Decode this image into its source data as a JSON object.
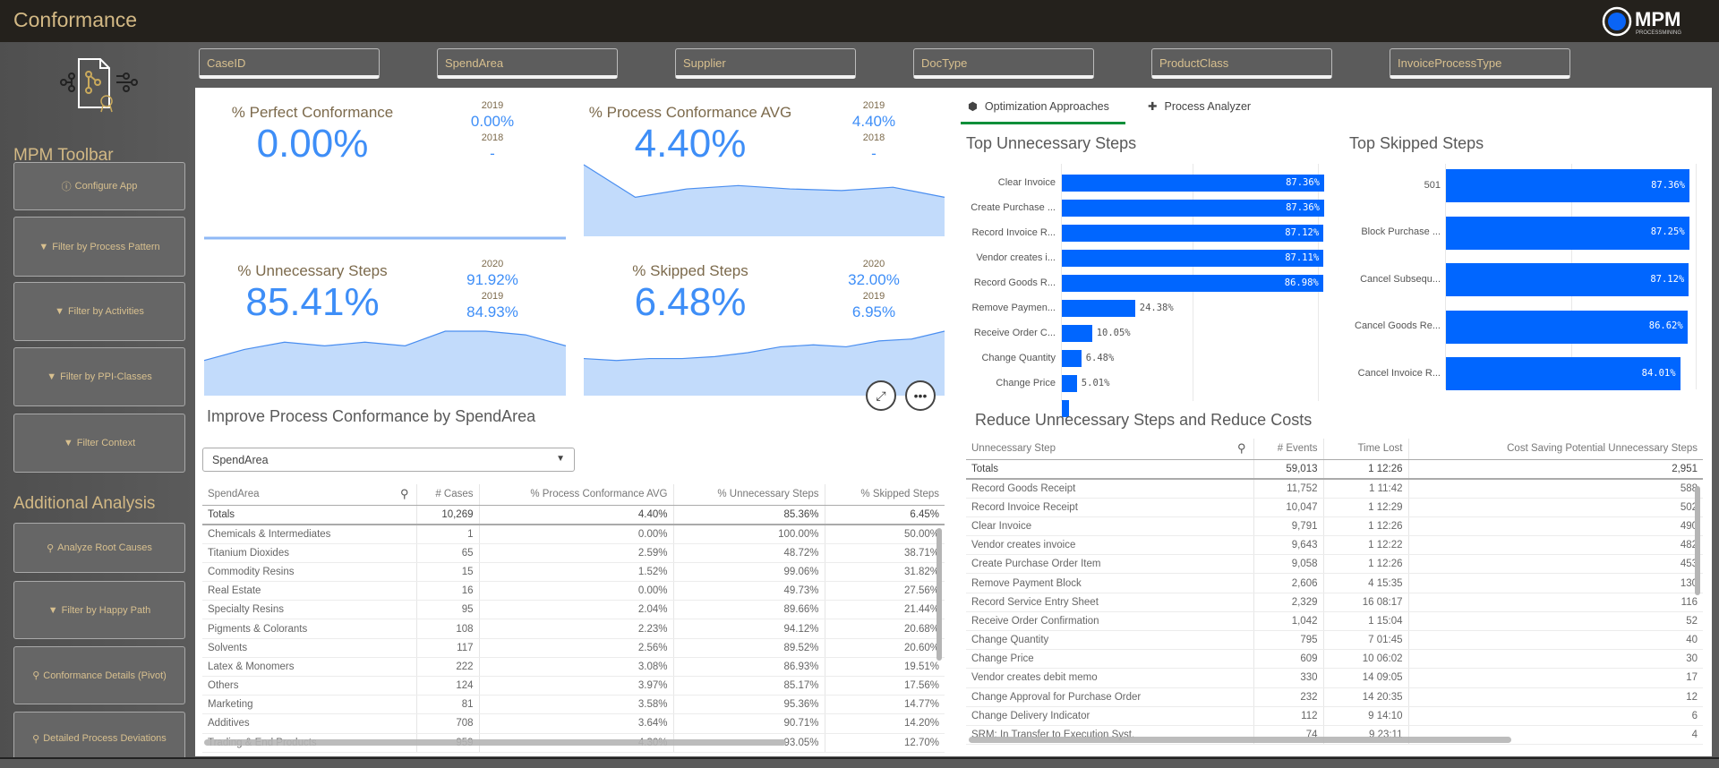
{
  "header": {
    "title": "Conformance",
    "logo_text": "MPM",
    "logo_sub": "ProcessMining",
    "logo_accent": "#0a64f5"
  },
  "filters": [
    "CaseID",
    "SpendArea",
    "Supplier",
    "DocType",
    "ProductClass",
    "InvoiceProcessType"
  ],
  "sidebar": {
    "toolbar_title": "MPM Toolbar",
    "toolbar_buttons": [
      {
        "label": "Configure App",
        "icon": "info-icon"
      },
      {
        "label": "Filter by Process Pattern",
        "icon": "filter-icon"
      },
      {
        "label": "Filter by Activities",
        "icon": "filter-icon"
      },
      {
        "label": "Filter by PPI-Classes",
        "icon": "filter-icon"
      },
      {
        "label": "Filter Context",
        "icon": "filter-icon"
      }
    ],
    "analysis_title": "Additional Analysis",
    "analysis_buttons": [
      {
        "label": "Analyze Root Causes",
        "icon": "search-icon"
      },
      {
        "label": "Filter by Happy Path",
        "icon": "filter-icon"
      },
      {
        "label": "Conformance Details (Pivot)",
        "icon": "search-icon"
      },
      {
        "label": "Detailed Process Deviations",
        "icon": "search-icon"
      }
    ]
  },
  "kpis": [
    {
      "title": "% Perfect Conformance",
      "value": "0.00%",
      "cmp": [
        {
          "year": "2019",
          "value": "0.00%"
        },
        {
          "year": "2018",
          "value": "-"
        }
      ],
      "trend": [
        0,
        0,
        0,
        0,
        0,
        0,
        0,
        0
      ]
    },
    {
      "title": "% Process Conformance AVG",
      "value": "4.40%",
      "cmp": [
        {
          "year": "2019",
          "value": "4.40%"
        },
        {
          "year": "2018",
          "value": "-"
        }
      ],
      "trend": [
        8.5,
        4.6,
        5.6,
        6.0,
        5.6,
        5.4,
        5.8,
        4.6
      ]
    },
    {
      "title": "% Unnecessary Steps",
      "value": "85.41%",
      "cmp": [
        {
          "year": "2020",
          "value": "91.92%"
        },
        {
          "year": "2019",
          "value": "84.93%"
        }
      ],
      "trend": [
        82,
        85,
        87,
        86,
        87,
        86,
        90,
        90,
        89,
        86
      ]
    },
    {
      "title": "% Skipped Steps",
      "value": "6.48%",
      "cmp": [
        {
          "year": "2020",
          "value": "32.00%"
        },
        {
          "year": "2019",
          "value": "6.95%"
        }
      ],
      "trend": [
        3,
        2.5,
        3,
        3,
        3.5,
        4.5,
        6,
        6.5,
        6,
        7.5,
        8,
        10
      ]
    }
  ],
  "spend": {
    "title": "Improve Process Conformance by SpendArea",
    "dimension_select": "SpendArea",
    "columns": [
      "SpendArea",
      "# Cases",
      "% Process Conformance AVG",
      "% Unnecessary Steps",
      "% Skipped Steps"
    ],
    "totals": [
      "Totals",
      "10,269",
      "4.40%",
      "85.36%",
      "6.45%"
    ],
    "rows": [
      [
        "Chemicals & Intermediates",
        "1",
        "0.00%",
        "100.00%",
        "50.00%"
      ],
      [
        "Titanium Dioxides",
        "65",
        "2.59%",
        "48.72%",
        "38.71%"
      ],
      [
        "Commodity Resins",
        "15",
        "1.52%",
        "99.06%",
        "31.82%"
      ],
      [
        "Real Estate",
        "16",
        "0.00%",
        "49.73%",
        "27.56%"
      ],
      [
        "Specialty Resins",
        "95",
        "2.04%",
        "89.66%",
        "21.44%"
      ],
      [
        "Pigments & Colorants",
        "108",
        "2.23%",
        "94.12%",
        "20.68%"
      ],
      [
        "Solvents",
        "117",
        "2.56%",
        "89.52%",
        "20.60%"
      ],
      [
        "Latex & Monomers",
        "222",
        "3.08%",
        "86.93%",
        "19.51%"
      ],
      [
        "Others",
        "124",
        "3.97%",
        "85.17%",
        "17.56%"
      ],
      [
        "Marketing",
        "81",
        "3.58%",
        "95.36%",
        "14.77%"
      ],
      [
        "Additives",
        "708",
        "3.64%",
        "90.71%",
        "14.20%"
      ],
      [
        "Trading & End Products",
        "959",
        "4.30%",
        "93.05%",
        "12.70%"
      ]
    ]
  },
  "tabs": [
    {
      "label": "Optimization Approaches",
      "icon": "cube-icon",
      "active": true
    },
    {
      "label": "Process Analyzer",
      "icon": "puzzle-icon",
      "active": false
    }
  ],
  "chart_data": [
    {
      "type": "bar",
      "orientation": "horizontal",
      "title": "Top Unnecessary Steps",
      "categories": [
        "Clear Invoice",
        "Create Purchase ...",
        "Record Invoice R...",
        "Vendor creates i...",
        "Record Goods R...",
        "Remove Paymen...",
        "Receive Order C...",
        "Change Quantity",
        "Change Price",
        ""
      ],
      "values": [
        87.36,
        87.36,
        87.12,
        87.11,
        86.98,
        24.38,
        10.05,
        6.48,
        5.01,
        2.3
      ],
      "labels": [
        "87.36%",
        "87.36%",
        "87.12%",
        "87.11%",
        "86.98%",
        "24.38%",
        "10.05%",
        "6.48%",
        "5.01%",
        ""
      ],
      "color": "#0066ff"
    },
    {
      "type": "bar",
      "orientation": "horizontal",
      "title": "Top Skipped Steps",
      "categories": [
        "501",
        "Block Purchase ...",
        "Cancel Subsequ...",
        "Cancel Goods Re...",
        "Cancel Invoice R..."
      ],
      "values": [
        87.36,
        87.25,
        87.12,
        86.62,
        84.01
      ],
      "labels": [
        "87.36%",
        "87.25%",
        "87.12%",
        "86.62%",
        "84.01%"
      ],
      "color": "#0066ff"
    }
  ],
  "costs": {
    "title": "Reduce Unnecessary Steps and Reduce Costs",
    "columns": [
      "Unnecessary Step",
      "# Events",
      "Time Lost",
      "Cost Saving Potential Unnecessary Steps"
    ],
    "totals": [
      "Totals",
      "59,013",
      "1 12:26",
      "2,951"
    ],
    "rows": [
      [
        "Record Goods Receipt",
        "11,752",
        "1 11:42",
        "588"
      ],
      [
        "Record Invoice Receipt",
        "10,047",
        "1 12:29",
        "502"
      ],
      [
        "Clear Invoice",
        "9,791",
        "1 12:26",
        "490"
      ],
      [
        "Vendor creates invoice",
        "9,643",
        "1 12:22",
        "482"
      ],
      [
        "Create Purchase Order Item",
        "9,058",
        "1 12:26",
        "453"
      ],
      [
        "Remove Payment Block",
        "2,606",
        "4 15:35",
        "130"
      ],
      [
        "Record Service Entry Sheet",
        "2,329",
        "16 08:17",
        "116"
      ],
      [
        "Receive Order Confirmation",
        "1,042",
        "1 15:04",
        "52"
      ],
      [
        "Change Quantity",
        "795",
        "7 01:45",
        "40"
      ],
      [
        "Change Price",
        "609",
        "10 06:02",
        "30"
      ],
      [
        "Vendor creates debit memo",
        "330",
        "14 09:05",
        "17"
      ],
      [
        "Change Approval for Purchase Order",
        "232",
        "14 20:35",
        "12"
      ],
      [
        "Change Delivery Indicator",
        "112",
        "9 14:10",
        "6"
      ],
      [
        "SRM: In Transfer to Execution Syst.",
        "74",
        "9 23:11",
        "4"
      ]
    ]
  }
}
